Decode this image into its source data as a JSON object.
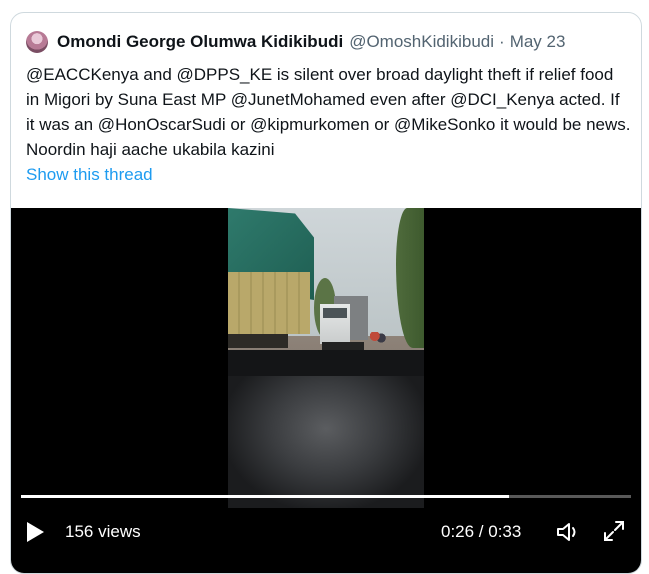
{
  "tweet": {
    "author_name": "Omondi George Olumwa Kidikibudi",
    "author_handle": "@OmoshKidikibudi",
    "separator": "·",
    "date": "May 23",
    "text": "@EACCKenya and @DPPS_KE is silent over broad daylight theft if relief food in Migori by Suna East MP @JunetMohamed even after @DCI_Kenya acted. If it was an @HonOscarSudi or @kipmurkomen or @MikeSonko it would be news. Noordin haji aache ukabila kazini",
    "show_thread_label": "Show this thread"
  },
  "video": {
    "views_label": "156 views",
    "time_label": "0:26 / 0:33",
    "progress": 0.8
  },
  "colors": {
    "link": "#1d9bf0",
    "text": "#0f1419",
    "muted": "#536471",
    "border": "#cfd9de"
  },
  "icons": [
    "avatar",
    "play-icon",
    "volume-icon",
    "fullscreen-icon"
  ]
}
